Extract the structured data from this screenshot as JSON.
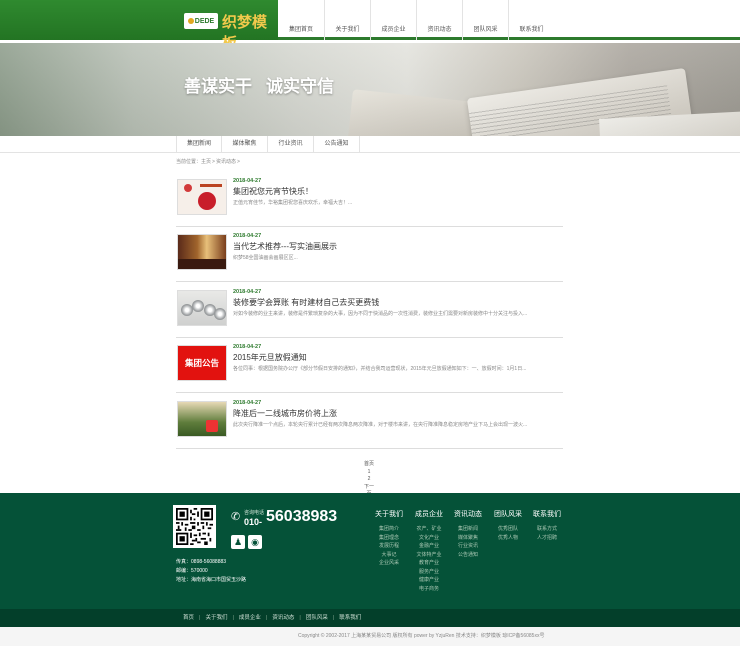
{
  "header": {
    "logo_badge": "DEDE",
    "logo_text": "织梦模板",
    "nav": [
      "集团首页",
      "关于我们",
      "成员企业",
      "资讯动态",
      "团队风采",
      "联系我们"
    ]
  },
  "banner": {
    "slogan_1": "善谋实干",
    "slogan_2": "诚实守信"
  },
  "subnav": [
    "集团新闻",
    "媒体聚焦",
    "行业资讯",
    "公告通知"
  ],
  "breadcrumb": {
    "label": "当前位置：",
    "home": "主页",
    "sep1": ">",
    "section": "资讯动态",
    "sep2": ">"
  },
  "news": [
    {
      "date": "2018-04-27",
      "title": "集团祝您元宵节快乐！",
      "desc": "正值元宵佳节，华裕集团祝您喜庆欢乐，幸福大吉！..."
    },
    {
      "date": "2018-04-27",
      "title": "当代艺术推荐---写实油画展示",
      "desc": "织梦58全国油画会画展区区..."
    },
    {
      "date": "2018-04-27",
      "title": "装修要学会算账 有时建材自己去买更费钱",
      "desc": "对如今装修的业主来讲，装修是件繁琐复杂的大事，因为不同于快消品的一次性消费，装修业主们需要对新房装修中十分关注与投入..."
    },
    {
      "date": "2018-04-27",
      "title": "2015年元旦放假通知",
      "desc": "各位同事：根据国务院办公厅《部分节假日安排的通知》，并结合我司运营现状，2015年元旦放假通知如下：一、放假时间：1月1日...",
      "thumb_text": "集团公告"
    },
    {
      "date": "2018-04-27",
      "title": "降准后一二线城市房价将上涨",
      "desc": "此次央行降准一个点后，本轮央行累计已经有两次降息两次降准，对于楼市来讲，在央行降准降息稳定房地产业下马上会出现一波火..."
    }
  ],
  "pager": [
    "首页",
    "1",
    "2",
    "下一页",
    "末页"
  ],
  "footer": {
    "hotline_label": "咨询电话",
    "phone_prefix": "010-",
    "phone_number": "56038983",
    "contacts": [
      {
        "label": "传真：",
        "value": "0898-56088883"
      },
      {
        "label": "邮编：",
        "value": "570000"
      },
      {
        "label": "地址：",
        "value": "海南省海口市国贸玉沙路"
      }
    ],
    "columns": [
      {
        "head": "关于我们",
        "links": [
          "集团简介",
          "集团理念",
          "发展历程",
          "大事记",
          "企业风采"
        ]
      },
      {
        "head": "成员企业",
        "links": [
          "农产、矿业",
          "文化产业",
          "金融产业",
          "文体特产业",
          "教育产业",
          "服务产业",
          "健康产业",
          "电子商务"
        ]
      },
      {
        "head": "资讯动态",
        "links": [
          "集团新闻",
          "媒体聚焦",
          "行业资讯",
          "公告通知"
        ]
      },
      {
        "head": "团队风采",
        "links": [
          "优秀团队",
          "优秀人物"
        ]
      },
      {
        "head": "联系我们",
        "links": [
          "联系方式",
          "人才招聘"
        ]
      }
    ],
    "bottom_nav": [
      "首页",
      "关于我们",
      "成员企业",
      "资讯动态",
      "团队风采",
      "联系我们"
    ],
    "copyright": "Copyright © 2002-2017 上海某某贸易公司 版权所有    power by YzjuRen    技术支持：织梦模板    琼ICP备56085xx号"
  },
  "colors": {
    "brand_green": "#2d7a2d",
    "footer_green": "#055238",
    "logo_gold": "#f2c94c",
    "notice_red": "#e2120f"
  }
}
